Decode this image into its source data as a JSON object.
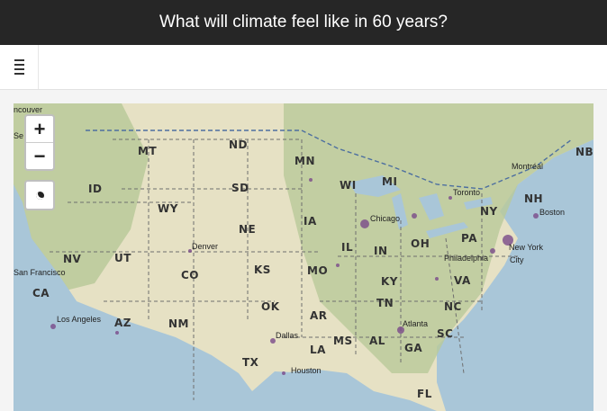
{
  "header": {
    "title": "What will climate feel like in 60 years?"
  },
  "toolbar": {
    "menu_icon": "bars-icon"
  },
  "map": {
    "zoom_in": "+",
    "zoom_out": "−",
    "locate_icon": "locate-icon",
    "colors": {
      "water": "#a9c6d8",
      "land": "#e6e1c4",
      "vegetation": "#b9c99a",
      "marker": "#7a4a8a"
    },
    "state_labels": [
      "MT",
      "ND",
      "MN",
      "WI",
      "MI",
      "ID",
      "SD",
      "WY",
      "IA",
      "NE",
      "IL",
      "IN",
      "OH",
      "NV",
      "UT",
      "CO",
      "KS",
      "MO",
      "KY",
      "CA",
      "AZ",
      "NM",
      "OK",
      "AR",
      "TN",
      "MS",
      "AL",
      "GA",
      "TX",
      "LA",
      "SC",
      "NC",
      "VA",
      "PA",
      "NY",
      "NH",
      "NB",
      "FL"
    ],
    "city_labels": [
      "Vancouver",
      "Seattle",
      "Montréal",
      "Toronto",
      "Boston",
      "Chicago",
      "New York City",
      "Philadelphia",
      "Denver",
      "San Francisco",
      "Los Angeles",
      "Dallas",
      "Atlanta",
      "Houston"
    ]
  }
}
